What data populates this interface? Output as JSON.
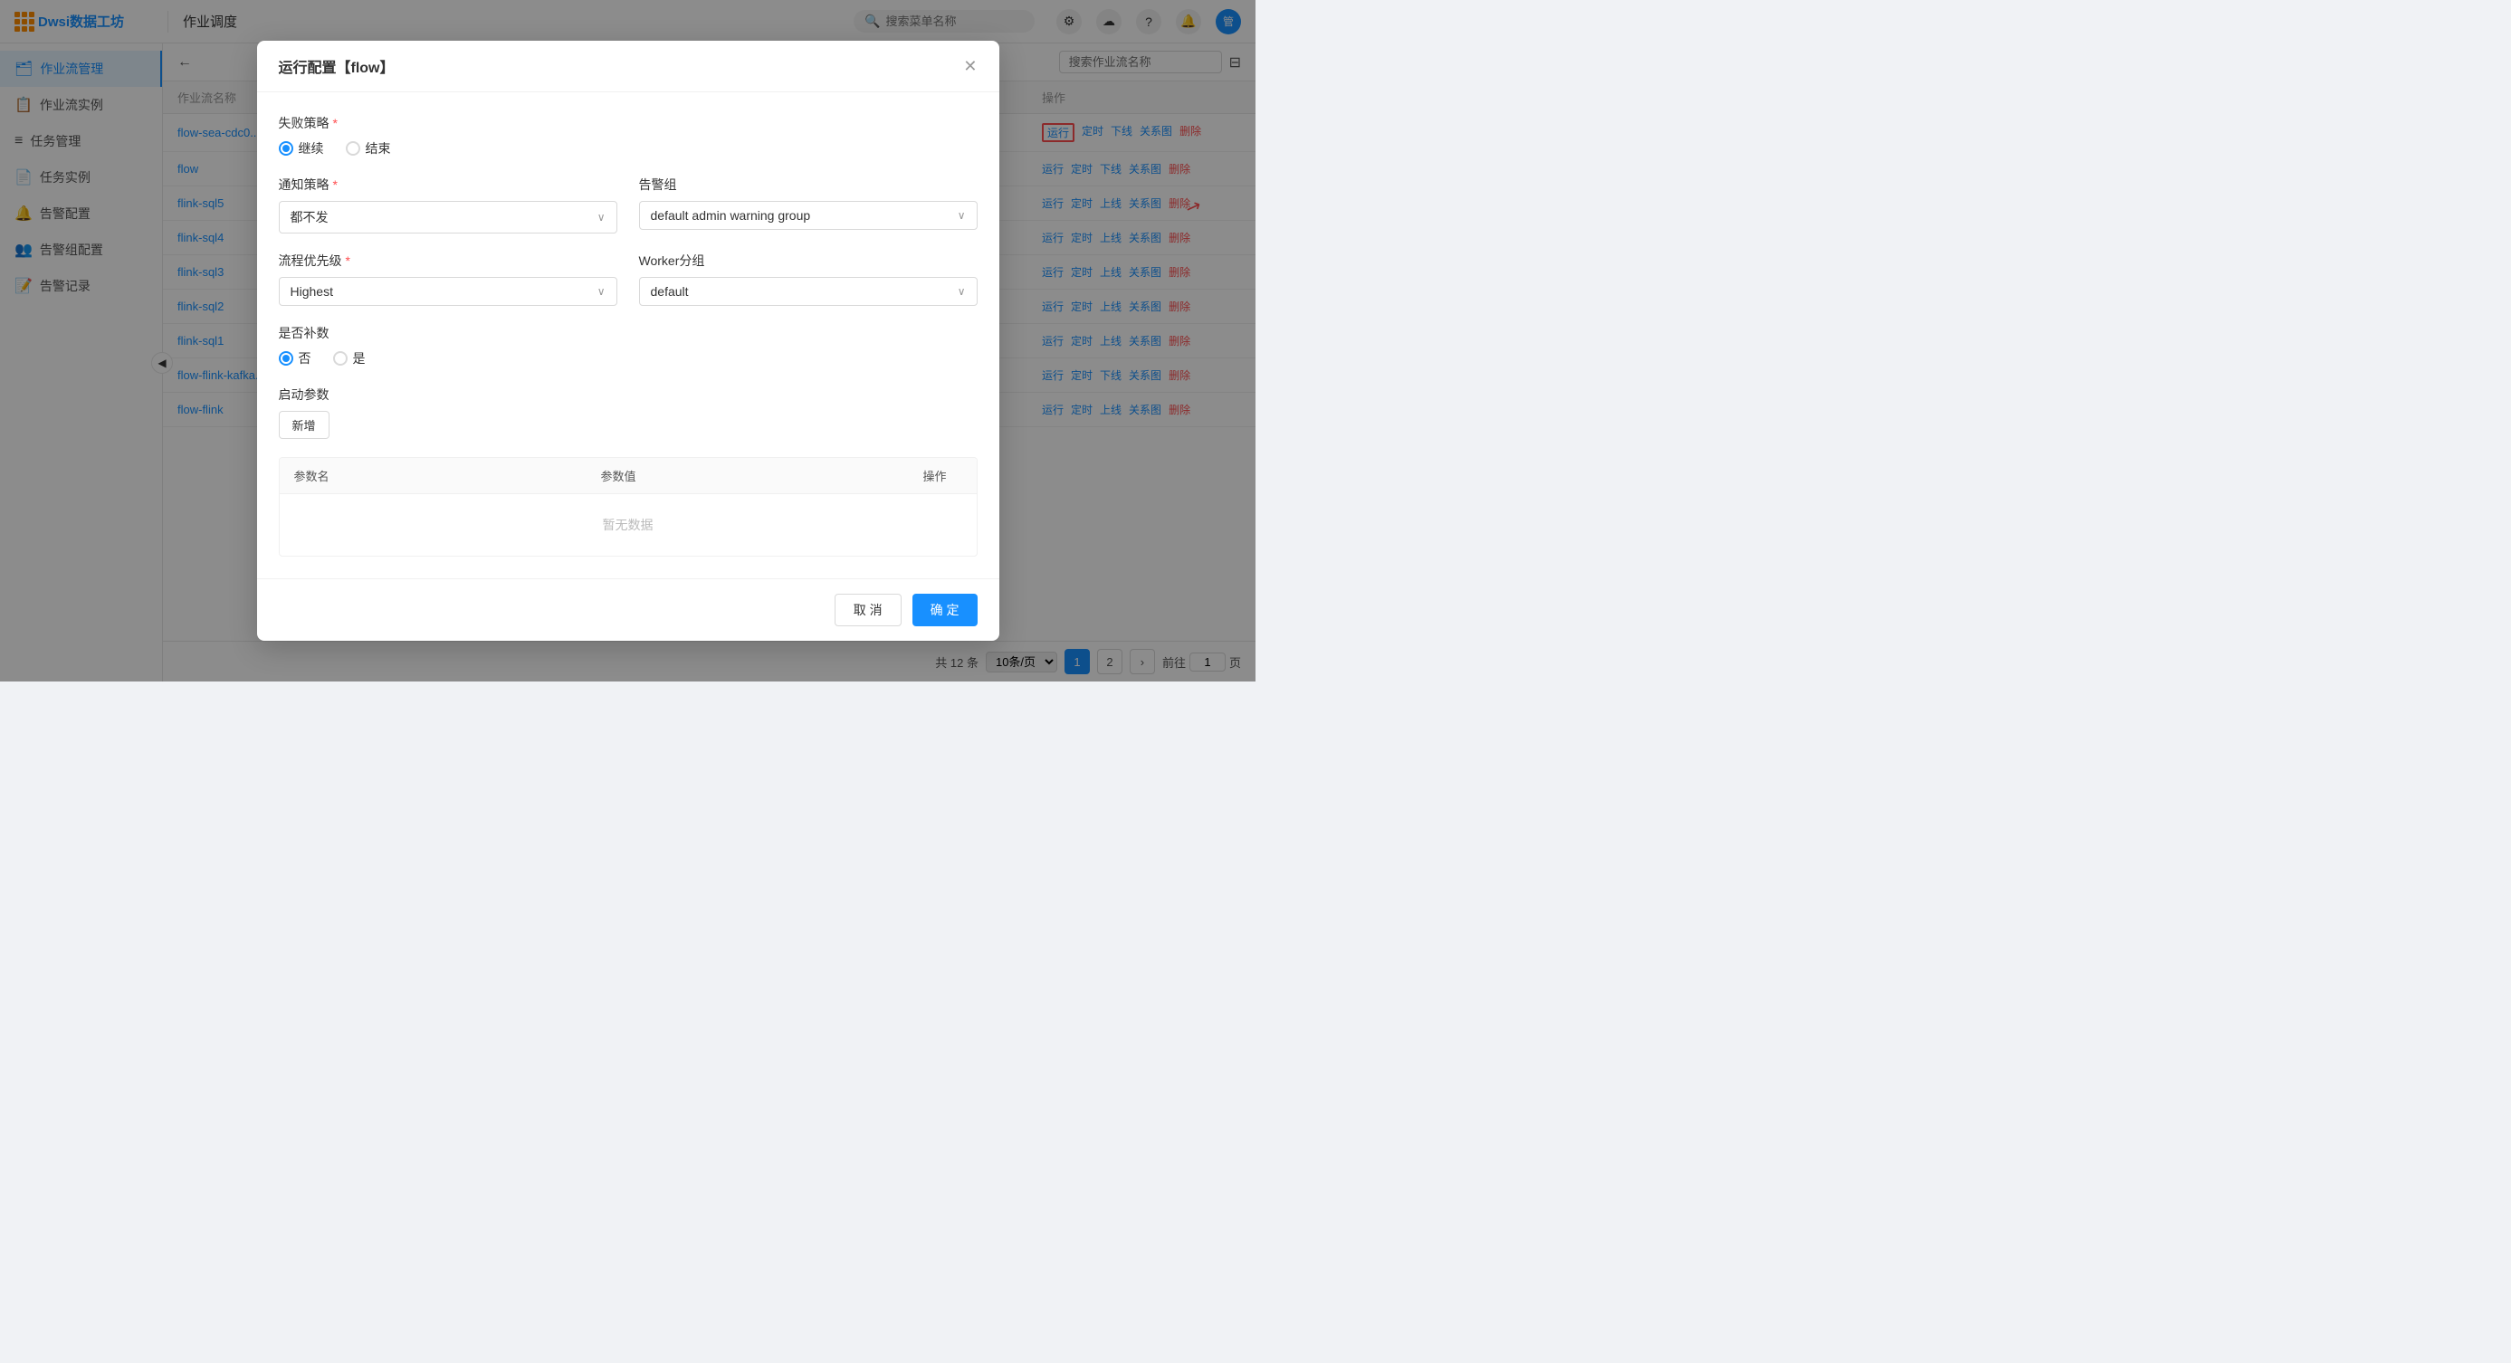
{
  "app": {
    "logo_text": "Dwsi数据工坊",
    "nav_title": "作业调度",
    "search_placeholder": "搜索菜单名称",
    "back_label": "←"
  },
  "sidebar": {
    "items": [
      {
        "id": "workflow-mgmt",
        "label": "作业流管理",
        "icon": "🗂",
        "active": true
      },
      {
        "id": "workflow-instance",
        "label": "作业流实例",
        "icon": "📋",
        "active": false
      },
      {
        "id": "task-mgmt",
        "label": "任务管理",
        "icon": "≡",
        "active": false
      },
      {
        "id": "task-instance",
        "label": "任务实例",
        "icon": "📄",
        "active": false
      },
      {
        "id": "alert-config",
        "label": "告警配置",
        "icon": "🔔",
        "active": false
      },
      {
        "id": "alert-group-config",
        "label": "告警组配置",
        "icon": "👥",
        "active": false
      },
      {
        "id": "alert-log",
        "label": "告警记录",
        "icon": "📝",
        "active": false
      }
    ]
  },
  "main": {
    "search_placeholder": "搜索作业流名称",
    "table_columns": [
      "作业流名称",
      "操作"
    ],
    "rows": [
      {
        "name": "flow-sea-cdc0...",
        "ops": [
          "运行",
          "定时",
          "下线",
          "关系图",
          "删除"
        ],
        "run_highlight": true,
        "ops_disabled": []
      },
      {
        "name": "flow",
        "ops": [
          "运行",
          "定时",
          "下线",
          "关系图",
          "删除"
        ],
        "run_highlight": false,
        "ops_disabled": []
      },
      {
        "name": "flink-sql5",
        "ops": [
          "运行",
          "定时",
          "上线",
          "关系图",
          "删除"
        ],
        "run_highlight": false,
        "ops_disabled": []
      },
      {
        "name": "flink-sql4",
        "ops": [
          "运行",
          "定时",
          "上线",
          "关系图",
          "删除"
        ],
        "run_highlight": false,
        "ops_disabled": []
      },
      {
        "name": "flink-sql3",
        "ops": [
          "运行",
          "定时",
          "上线",
          "关系图",
          "删除"
        ],
        "run_highlight": false,
        "ops_disabled": []
      },
      {
        "name": "flink-sql2",
        "ops": [
          "运行",
          "定时",
          "上线",
          "关系图",
          "删除"
        ],
        "run_highlight": false,
        "ops_disabled": []
      },
      {
        "name": "flink-sql1",
        "ops": [
          "运行",
          "定时",
          "上线",
          "关系图",
          "删除"
        ],
        "run_highlight": false,
        "ops_disabled": []
      },
      {
        "name": "flow-flink-kafka...",
        "ops": [
          "运行",
          "定时",
          "下线",
          "关系图",
          "删除"
        ],
        "run_highlight": false,
        "ops_disabled": []
      },
      {
        "name": "flow-flink",
        "ops": [
          "运行",
          "定时",
          "上线",
          "关系图",
          "删除"
        ],
        "run_highlight": false,
        "ops_disabled": []
      }
    ],
    "pagination": {
      "total_text": "共 12 条",
      "page_size": "10条/页",
      "current_page": 1,
      "total_pages": 2,
      "goto_label": "前往",
      "page_label": "页",
      "goto_value": "1"
    }
  },
  "modal": {
    "title": "运行配置【flow】",
    "close_label": "✕",
    "failure_policy_label": "失败策略",
    "failure_policy_required": "*",
    "failure_options": [
      {
        "id": "continue",
        "label": "继续",
        "checked": true
      },
      {
        "id": "end",
        "label": "结束",
        "checked": false
      }
    ],
    "notify_policy_label": "通知策略",
    "notify_policy_required": "*",
    "notify_policy_value": "都不发",
    "alert_group_label": "告警组",
    "alert_group_value": "default admin warning group",
    "priority_label": "流程优先级",
    "priority_required": "*",
    "priority_value": "Highest",
    "worker_group_label": "Worker分组",
    "worker_group_value": "default",
    "complement_label": "是否补数",
    "complement_options": [
      {
        "id": "no",
        "label": "否",
        "checked": true
      },
      {
        "id": "yes",
        "label": "是",
        "checked": false
      }
    ],
    "startup_params_label": "启动参数",
    "add_btn_label": "新增",
    "params_table": {
      "columns": [
        "参数名",
        "参数值",
        "操作"
      ],
      "empty_text": "暂无数据"
    },
    "cancel_btn": "取 消",
    "confirm_btn": "确 定"
  },
  "icons": {
    "search": "🔍",
    "settings": "⚙",
    "help": "?",
    "bell": "🔔",
    "filter": "⊟",
    "chevron_down": "∨",
    "collapse": "◀"
  }
}
